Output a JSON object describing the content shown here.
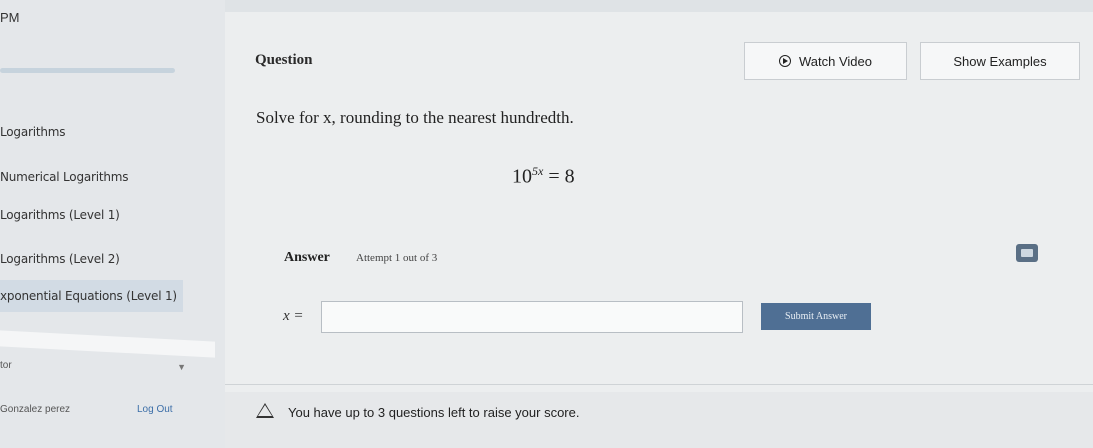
{
  "status": {
    "time": "PM"
  },
  "sidebar": {
    "progress_percent": 0,
    "items": [
      {
        "label": "Logarithms"
      },
      {
        "label": "Numerical Logarithms"
      },
      {
        "label": "Logarithms (Level 1)"
      },
      {
        "label": "Logarithms (Level 2)"
      },
      {
        "label": "xponential Equations (Level 1)"
      }
    ],
    "select_label": "tor",
    "user_name": "Gonzalez perez",
    "logout_label": "Log Out"
  },
  "question": {
    "heading": "Question",
    "watch_video_label": "Watch Video",
    "show_examples_label": "Show Examples",
    "instruction": "Solve for x, rounding to the nearest hundredth.",
    "equation_base": "10",
    "equation_exponent": "5x",
    "equation_rhs": "= 8"
  },
  "answer": {
    "label": "Answer",
    "attempt_text": "Attempt 1 out of 3",
    "variable_label": "x =",
    "input_value": "",
    "submit_label": "Submit Answer"
  },
  "footer": {
    "message": "You have up to 3 questions left to raise your score."
  }
}
